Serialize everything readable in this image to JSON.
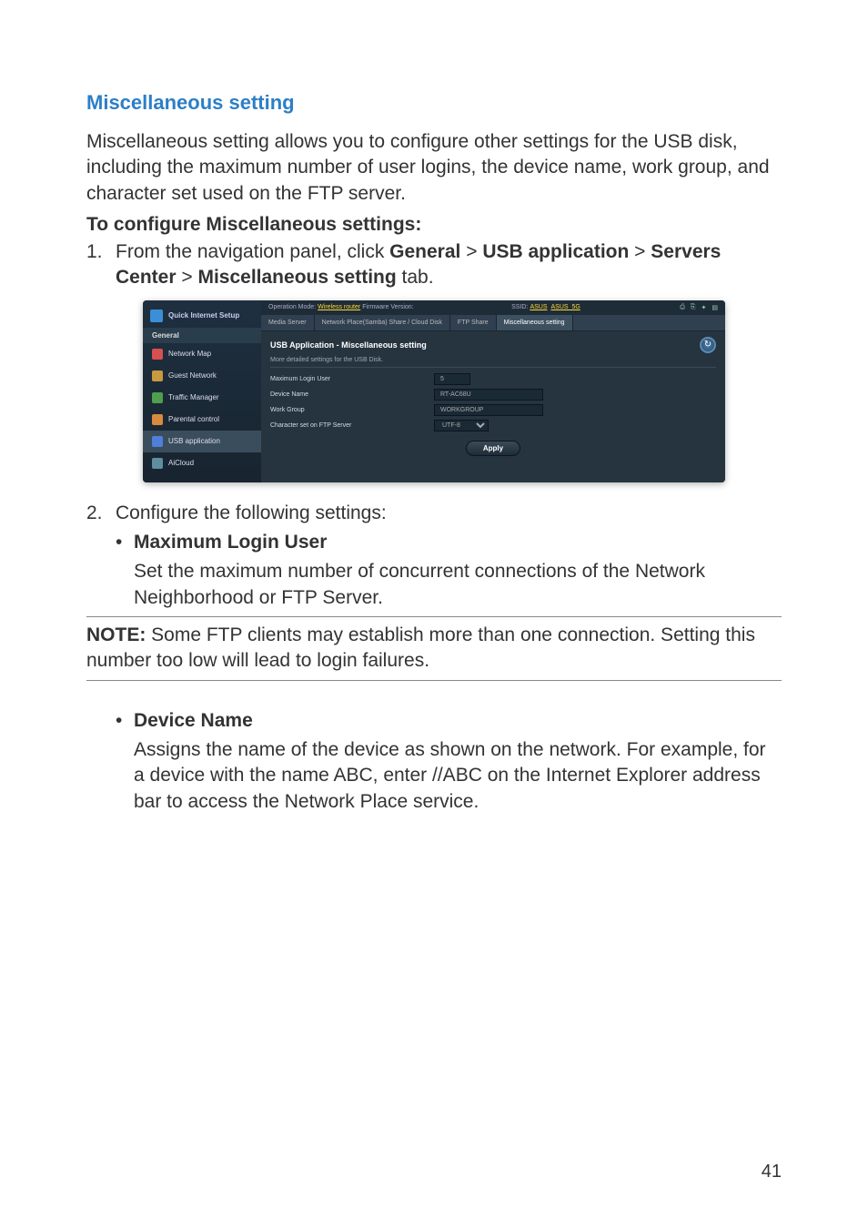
{
  "sectionTitle": "Miscellaneous setting",
  "intro": "Miscellaneous setting allows you to configure other settings for the USB disk, including the maximum number of user logins, the device name, work group, and character set used on the FTP server.",
  "configHeading": "To configure Miscellaneous settings:",
  "step1": {
    "num": "1.",
    "prefix": "From the navigation panel, click ",
    "b1": "General",
    "sep1": " > ",
    "b2": "USB application",
    "sep2": " > ",
    "b3": "Servers Center",
    "sep3": " > ",
    "b4": "Miscellaneous setting",
    "suffix": " tab."
  },
  "router": {
    "qis": "Quick Internet Setup",
    "general": "General",
    "items": [
      "Network Map",
      "Guest Network",
      "Traffic Manager",
      "Parental control",
      "USB application",
      "AiCloud"
    ],
    "topbar": {
      "mode": "Operation Mode:",
      "wifi": "Wireless router",
      "fw": "Firmware Version:",
      "ssidLabel": "SSID:",
      "ssid1": "ASUS",
      "ssid2": "ASUS_5G"
    },
    "tabs": [
      "Media Server",
      "Network Place(Samba) Share / Cloud Disk",
      "FTP Share",
      "Miscellaneous setting"
    ],
    "contentTitle": "USB Application - Miscellaneous setting",
    "contentSub": "More detailed settings for the USB Disk.",
    "rows": {
      "maxLogin": {
        "label": "Maximum Login User",
        "value": "5"
      },
      "deviceName": {
        "label": "Device Name",
        "value": "RT-AC68U"
      },
      "workGroup": {
        "label": "Work Group",
        "value": "WORKGROUP"
      },
      "charset": {
        "label": "Character set on FTP Server",
        "value": "UTF-8"
      }
    },
    "apply": "Apply"
  },
  "step2": {
    "num": "2.",
    "text": "Configure the following settings:"
  },
  "bullet1": {
    "heading": "Maximum Login User",
    "text": "Set the maximum number of concurrent connections of the Network Neighborhood or FTP Server."
  },
  "note": {
    "label": "NOTE:",
    "text": " Some FTP clients may establish more than one connection. Setting this number too low will lead to login failures."
  },
  "bullet2": {
    "heading": "Device Name",
    "text": "Assigns the name of the device as shown on the network. For example, for a device with the name ABC, enter //ABC on the Internet Explorer address bar to access the Network Place service."
  },
  "pageNumber": "41"
}
